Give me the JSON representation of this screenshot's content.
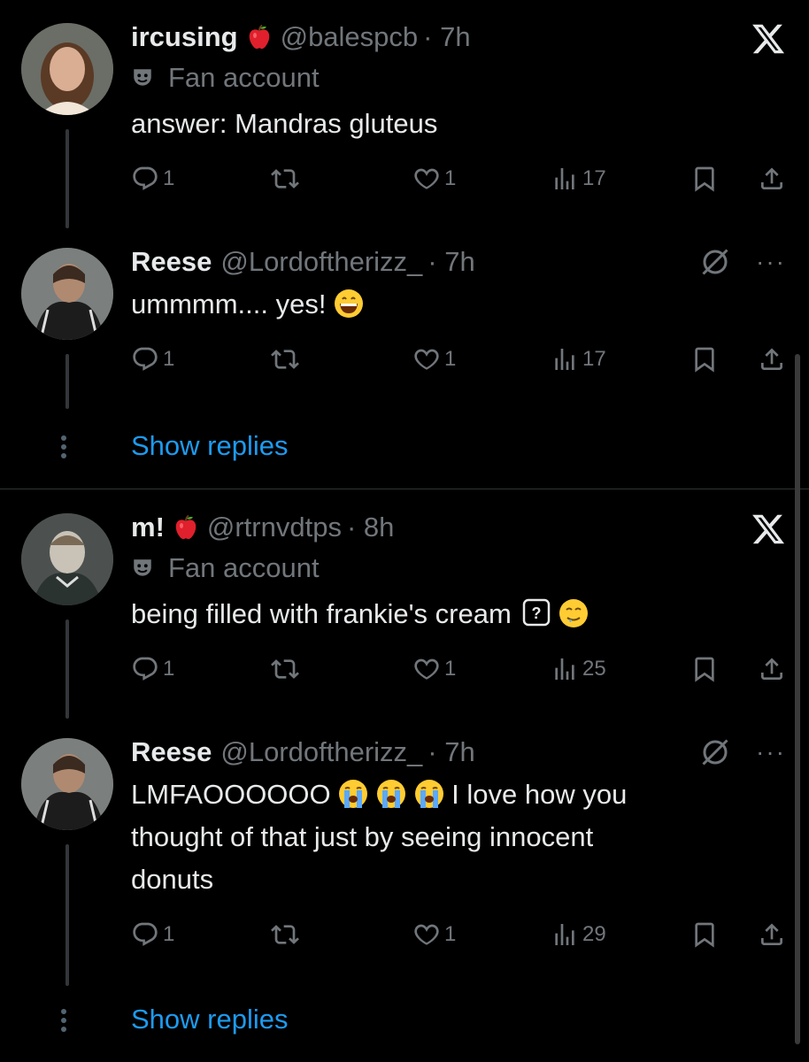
{
  "posts": [
    {
      "name": "ircusing",
      "handle": "@balespcb",
      "time": "· 7h",
      "badge": "Fan account",
      "text": "answer: Mandras gluteus",
      "replies": "1",
      "likes": "1",
      "views": "17",
      "corner": "x-logo-icon"
    },
    {
      "name": "Reese",
      "handle": "@Lordoftherizz_",
      "time": "· 7h",
      "text": "ummmm.... yes!",
      "replies": "1",
      "likes": "1",
      "views": "17",
      "corner": "grok-icon"
    },
    {
      "name": "m!",
      "handle": "@rtrnvdtps",
      "time": "· 8h",
      "badge": "Fan account",
      "text": "being filled with frankie's cream",
      "replies": "1",
      "likes": "1",
      "views": "25",
      "corner": "x-logo-icon"
    },
    {
      "name": "Reese",
      "handle": "@Lordoftherizz_",
      "time": "· 7h",
      "text_line1_a": "LMFAOOOOOO",
      "text_line1_b": "I love how you",
      "text_line2": "thought of that just by seeing innocent",
      "text_line3": "donuts",
      "replies": "1",
      "likes": "1",
      "views": "29",
      "corner": "grok-icon"
    }
  ],
  "show_replies": "Show replies",
  "colors": {
    "background": "#000000",
    "text": "#e7e9ea",
    "secondary": "#71767b",
    "link": "#1d9bf0"
  }
}
